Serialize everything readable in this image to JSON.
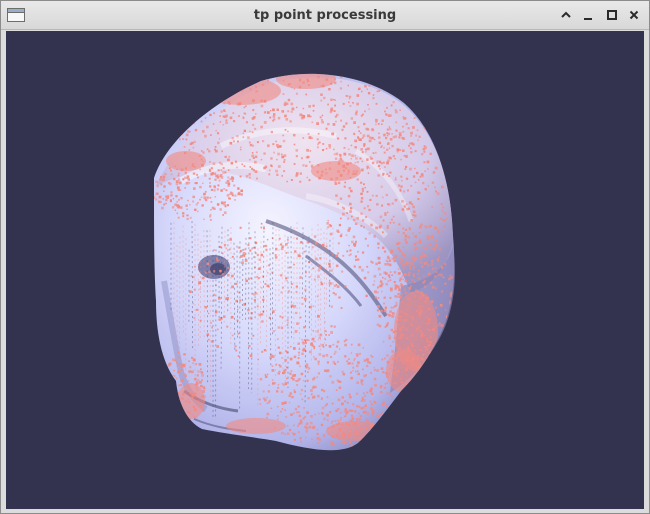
{
  "window": {
    "title": "tp point processing",
    "controls": {
      "shade": "chevron-up-icon",
      "minimize": "minimize-icon",
      "maximize": "maximize-icon",
      "close": "close-icon"
    }
  },
  "scene": {
    "background_color": "#34334f",
    "mesh_color": "#c7c9f8",
    "point_color": "#f28a82",
    "description_object": "3d-head-model"
  }
}
